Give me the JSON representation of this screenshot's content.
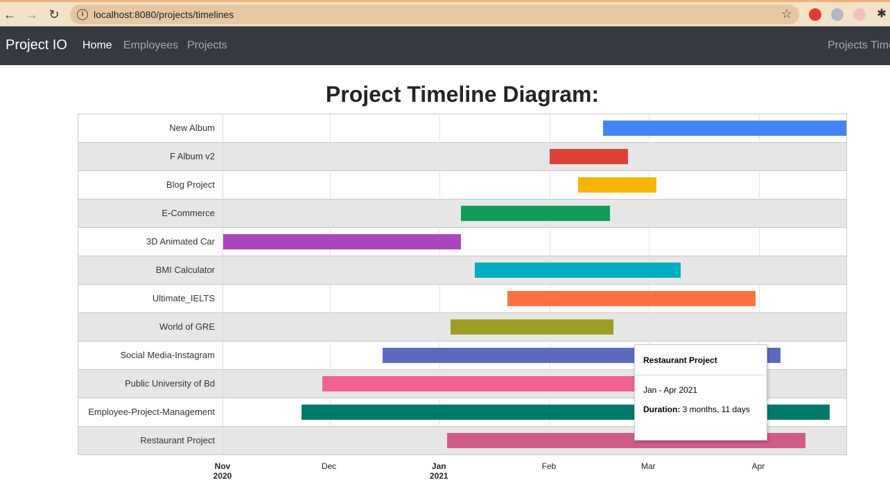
{
  "browser": {
    "url": "localhost:8080/projects/timelines"
  },
  "navbar": {
    "brand": "Project IO",
    "links": [
      "Home",
      "Employees",
      "Projects"
    ],
    "right_link": "Projects Timelines"
  },
  "page": {
    "title": "Project Timeline Diagram:"
  },
  "chart_data": {
    "type": "timeline",
    "axis_start": "2020-11-01",
    "axis_end": "2021-04-26",
    "ticks": [
      {
        "date": "2020-11-01",
        "label": "Nov",
        "sub": "2020",
        "bold": true
      },
      {
        "date": "2020-12-01",
        "label": "Dec",
        "sub": "",
        "bold": false
      },
      {
        "date": "2021-01-01",
        "label": "Jan",
        "sub": "2021",
        "bold": true
      },
      {
        "date": "2021-02-01",
        "label": "Feb",
        "sub": "",
        "bold": false
      },
      {
        "date": "2021-03-01",
        "label": "Mar",
        "sub": "",
        "bold": false
      },
      {
        "date": "2021-04-01",
        "label": "Apr",
        "sub": "",
        "bold": false
      }
    ],
    "rows": [
      {
        "name": "New Album",
        "start": "2021-02-16",
        "end": "2021-04-26",
        "color": "#4285f4"
      },
      {
        "name": "F Album v2",
        "start": "2021-02-01",
        "end": "2021-02-23",
        "color": "#db4437"
      },
      {
        "name": "Blog Project",
        "start": "2021-02-09",
        "end": "2021-03-03",
        "color": "#f4b400"
      },
      {
        "name": "E-Commerce",
        "start": "2021-01-07",
        "end": "2021-02-18",
        "color": "#0f9d58"
      },
      {
        "name": "3D Animated Car",
        "start": "2020-11-01",
        "end": "2021-01-07",
        "color": "#ab47bc"
      },
      {
        "name": "BMI Calculator",
        "start": "2021-01-11",
        "end": "2021-03-10",
        "color": "#00acc1"
      },
      {
        "name": "Ultimate_IELTS",
        "start": "2021-01-20",
        "end": "2021-03-31",
        "color": "#ff7043"
      },
      {
        "name": "World of GRE",
        "start": "2021-01-04",
        "end": "2021-02-19",
        "color": "#9e9d24"
      },
      {
        "name": "Social Media-Instagram",
        "start": "2020-12-16",
        "end": "2021-04-07",
        "color": "#5c6bc0"
      },
      {
        "name": "Public University of Bd",
        "start": "2020-11-29",
        "end": "2021-03-16",
        "color": "#f06292"
      },
      {
        "name": "Employee-Project-Management",
        "start": "2020-11-23",
        "end": "2021-04-21",
        "color": "#00796b"
      },
      {
        "name": "Restaurant Project",
        "start": "2021-01-03",
        "end": "2021-04-14",
        "color": "#d25b8a"
      }
    ]
  },
  "tooltip": {
    "title": "Restaurant Project",
    "range": "Jan - Apr 2021",
    "duration_label": "Duration:",
    "duration_value": "3 months, 11 days"
  }
}
